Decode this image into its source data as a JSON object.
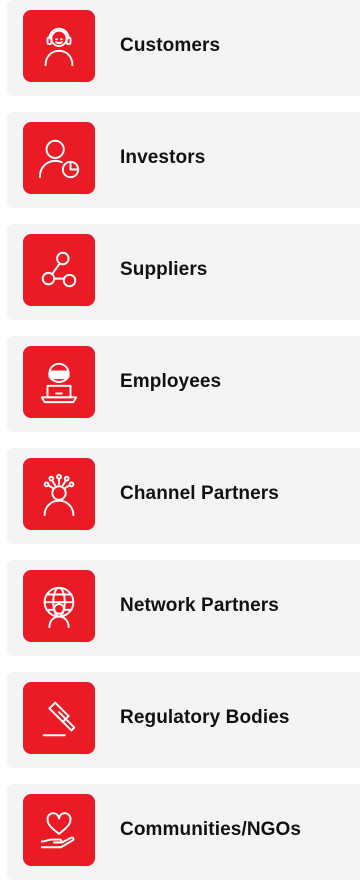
{
  "stakeholders": {
    "items": [
      {
        "label": "Customers",
        "icon": "customer-headset-icon"
      },
      {
        "label": "Investors",
        "icon": "investor-chart-icon"
      },
      {
        "label": "Suppliers",
        "icon": "supplier-network-icon"
      },
      {
        "label": "Employees",
        "icon": "employee-laptop-icon"
      },
      {
        "label": "Channel Partners",
        "icon": "channel-partner-network-icon"
      },
      {
        "label": "Network Partners",
        "icon": "network-partner-globe-icon"
      },
      {
        "label": "Regulatory Bodies",
        "icon": "gavel-icon"
      },
      {
        "label": "Communities/NGOs",
        "icon": "heart-hand-icon"
      }
    ],
    "accent_color": "#ea1b24",
    "card_color": "#f4f4f4"
  }
}
